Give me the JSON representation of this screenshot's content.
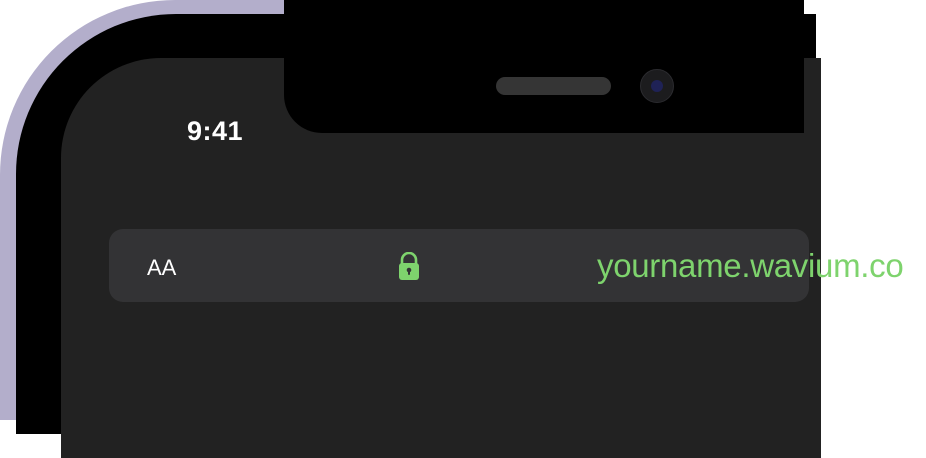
{
  "status_bar": {
    "time": "9:41"
  },
  "address_bar": {
    "text_size_label": "AA",
    "lock_icon": "lock-icon",
    "url": "yourname.wavium.co"
  },
  "colors": {
    "frame": "#b3aecb",
    "bezel": "#000000",
    "screen": "#222222",
    "address_bar_bg": "#333335",
    "accent_green": "#7ed36d",
    "camera_lens": "#1f2256"
  }
}
